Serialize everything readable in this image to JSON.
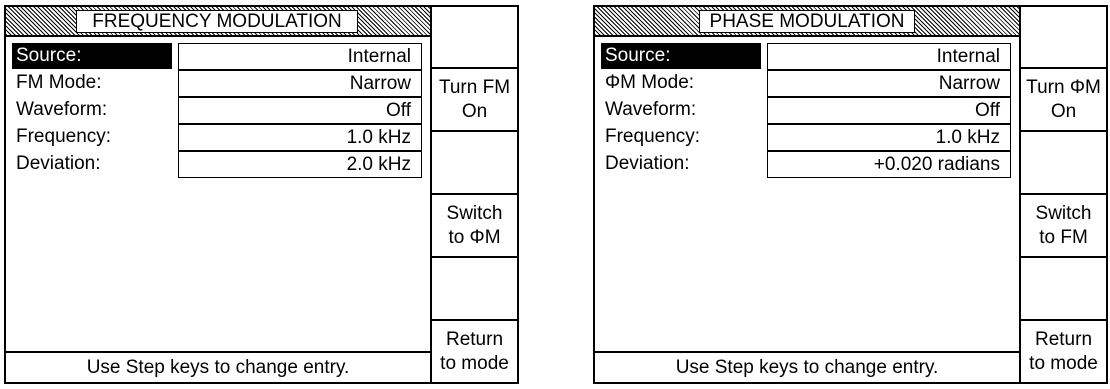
{
  "fm": {
    "title": "FREQUENCY MODULATION",
    "rows": [
      {
        "label": "Source:",
        "value": "Internal"
      },
      {
        "label": "FM Mode:",
        "value": "Narrow"
      },
      {
        "label": "Waveform:",
        "value": "Off"
      },
      {
        "label": "Frequency:",
        "value": "1.0 kHz"
      },
      {
        "label": "Deviation:",
        "value": "2.0 kHz"
      }
    ],
    "status": "Use Step keys to change entry.",
    "softkeys": [
      {
        "line1": "",
        "line2": ""
      },
      {
        "line1": "Turn FM",
        "line2": "On"
      },
      {
        "line1": "",
        "line2": ""
      },
      {
        "line1": "Switch",
        "line2": "to ΦM"
      },
      {
        "line1": "",
        "line2": ""
      },
      {
        "line1": "Return",
        "line2": "to mode"
      }
    ]
  },
  "pm": {
    "title": "PHASE MODULATION",
    "rows": [
      {
        "label": "Source:",
        "value": "Internal"
      },
      {
        "label": "ΦM Mode:",
        "value": "Narrow"
      },
      {
        "label": "Waveform:",
        "value": "Off"
      },
      {
        "label": "Frequency:",
        "value": "1.0 kHz"
      },
      {
        "label": "Deviation:",
        "value": "+0.020 radians"
      }
    ],
    "status": "Use Step keys to change entry.",
    "softkeys": [
      {
        "line1": "",
        "line2": ""
      },
      {
        "line1": "Turn ΦM",
        "line2": "On"
      },
      {
        "line1": "",
        "line2": ""
      },
      {
        "line1": "Switch",
        "line2": "to FM"
      },
      {
        "line1": "",
        "line2": ""
      },
      {
        "line1": "Return",
        "line2": "to mode"
      }
    ]
  }
}
